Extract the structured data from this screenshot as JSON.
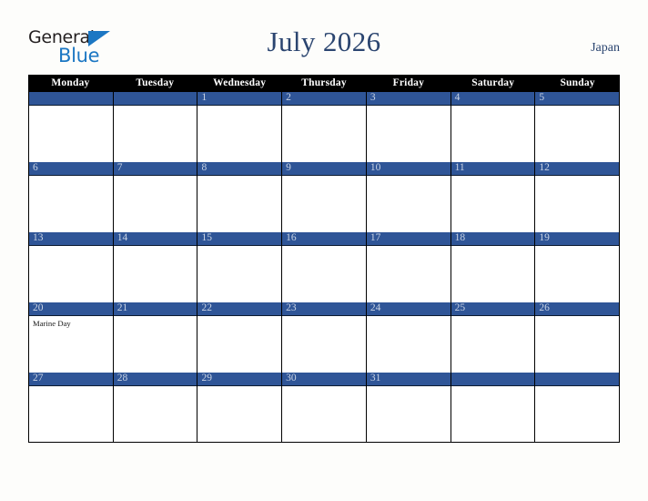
{
  "brand": {
    "word_one": "General",
    "word_two": "Blue",
    "triangle_color": "#1c77c3",
    "text_color": "#231f20"
  },
  "header": {
    "title": "July 2026",
    "country": "Japan",
    "title_color": "#2b4570"
  },
  "calendar": {
    "month": "July",
    "year": "2026",
    "weekday_headers": [
      "Monday",
      "Tuesday",
      "Wednesday",
      "Thursday",
      "Friday",
      "Saturday",
      "Sunday"
    ],
    "header_bg": "#000000",
    "header_text": "#ffffff",
    "daybar_bg": "#2f5597",
    "daynum_color": "#c9d3e4",
    "cell_bg": "#ffffff",
    "grid_line": "#000000",
    "weeks": [
      [
        {
          "day": "",
          "events": []
        },
        {
          "day": "",
          "events": []
        },
        {
          "day": "1",
          "events": []
        },
        {
          "day": "2",
          "events": []
        },
        {
          "day": "3",
          "events": []
        },
        {
          "day": "4",
          "events": []
        },
        {
          "day": "5",
          "events": []
        }
      ],
      [
        {
          "day": "6",
          "events": []
        },
        {
          "day": "7",
          "events": []
        },
        {
          "day": "8",
          "events": []
        },
        {
          "day": "9",
          "events": []
        },
        {
          "day": "10",
          "events": []
        },
        {
          "day": "11",
          "events": []
        },
        {
          "day": "12",
          "events": []
        }
      ],
      [
        {
          "day": "13",
          "events": []
        },
        {
          "day": "14",
          "events": []
        },
        {
          "day": "15",
          "events": []
        },
        {
          "day": "16",
          "events": []
        },
        {
          "day": "17",
          "events": []
        },
        {
          "day": "18",
          "events": []
        },
        {
          "day": "19",
          "events": []
        }
      ],
      [
        {
          "day": "20",
          "events": [
            "Marine Day"
          ]
        },
        {
          "day": "21",
          "events": []
        },
        {
          "day": "22",
          "events": []
        },
        {
          "day": "23",
          "events": []
        },
        {
          "day": "24",
          "events": []
        },
        {
          "day": "25",
          "events": []
        },
        {
          "day": "26",
          "events": []
        }
      ],
      [
        {
          "day": "27",
          "events": []
        },
        {
          "day": "28",
          "events": []
        },
        {
          "day": "29",
          "events": []
        },
        {
          "day": "30",
          "events": []
        },
        {
          "day": "31",
          "events": []
        },
        {
          "day": "",
          "events": []
        },
        {
          "day": "",
          "events": []
        }
      ]
    ]
  }
}
